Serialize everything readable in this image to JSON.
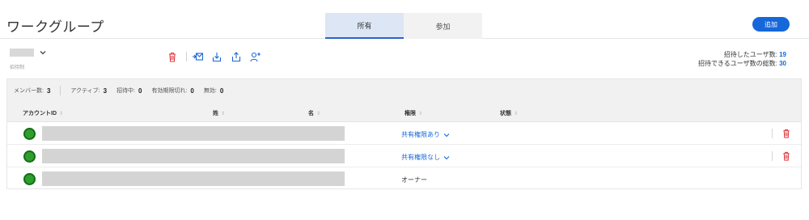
{
  "header": {
    "title": "ワークグループ",
    "tabs": [
      {
        "label": "所有",
        "active": true
      },
      {
        "label": "参加",
        "active": false
      }
    ],
    "add_label": "追加"
  },
  "group": {
    "subtitle": "招待制"
  },
  "toolbar": {
    "icons": [
      "trash-icon",
      "mail-import-icon",
      "download-icon",
      "upload-icon",
      "add-user-icon"
    ]
  },
  "stats": {
    "invited_label": "招待したユーザ数:",
    "invited_value": "19",
    "capacity_label": "招待できるユーザ数の総数:",
    "capacity_value": "30"
  },
  "summary": {
    "members_label": "メンバー数:",
    "members_value": "3",
    "active_label": "アクティブ:",
    "active_value": "3",
    "inviting_label": "招待中:",
    "inviting_value": "0",
    "expired_label": "有効期限切れ:",
    "expired_value": "0",
    "disabled_label": "無効:",
    "disabled_value": "0"
  },
  "table": {
    "columns": [
      "アカウントID",
      "姓",
      "名",
      "権限",
      "状態"
    ],
    "rows": [
      {
        "permission": "共有権限あり",
        "type": "dropdown",
        "deletable": true
      },
      {
        "permission": "共有権限なし",
        "type": "dropdown",
        "deletable": true
      },
      {
        "permission": "オーナー",
        "type": "static",
        "deletable": false
      }
    ]
  },
  "colors": {
    "accent": "#1667d9",
    "danger": "#e0393e",
    "avatar": "#2f9e2f"
  }
}
